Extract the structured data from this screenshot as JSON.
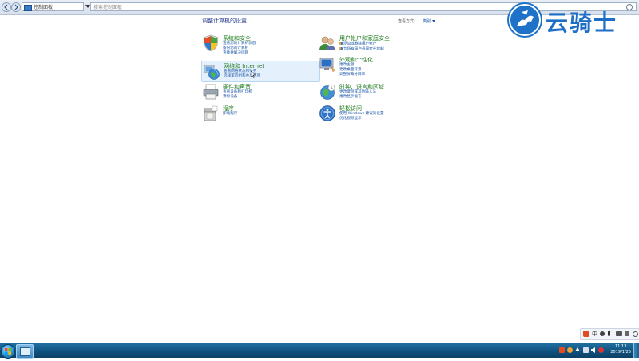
{
  "address_bar": {
    "path": "控制面板",
    "search_placeholder": "搜索控制面板"
  },
  "page_title": "调整计算机的设置",
  "view_by": {
    "label": "查看方式:",
    "value": "类别"
  },
  "categories": [
    {
      "id": "system",
      "title": "系统和安全",
      "links": [
        "查看您的计算机状态",
        "备份您的计算机",
        "查找并解决问题"
      ],
      "icon": "shield-icon"
    },
    {
      "id": "network",
      "title": "网络和 Internet",
      "links": [
        "查看网络状态和任务",
        "选择家庭组和共享选项"
      ],
      "icon": "network-globe-icon"
    },
    {
      "id": "hardware",
      "title": "硬件和声音",
      "links": [
        "查看设备和打印机",
        "添加设备"
      ],
      "icon": "printer-icon"
    },
    {
      "id": "programs",
      "title": "程序",
      "links": [
        "卸载程序"
      ],
      "icon": "programs-icon"
    },
    {
      "id": "users",
      "title": "用户帐户和家庭安全",
      "links": [
        "添加或删除用户帐户",
        "为所有用户设置家长控制"
      ],
      "icon": "users-icon"
    },
    {
      "id": "appearance",
      "title": "外观和个性化",
      "links": [
        "更改主题",
        "更改桌面背景",
        "调整屏幕分辨率"
      ],
      "icon": "appearance-icon"
    },
    {
      "id": "clock",
      "title": "时钟、语言和区域",
      "links": [
        "更改键盘或其他输入法",
        "更改显示语言"
      ],
      "icon": "clock-globe-icon"
    },
    {
      "id": "ease",
      "title": "轻松访问",
      "links": [
        "使用 Windows 建议的设置",
        "优化视频显示"
      ],
      "icon": "ease-of-access-icon"
    }
  ],
  "watermark": {
    "text": "云骑士"
  },
  "taskbar": {
    "time": "11:13",
    "date": "2019/1/25"
  },
  "colors": {
    "category_title": "#1c7a1c",
    "link": "#1e58a8",
    "page_title": "#1e3287",
    "taskbar": "#0d4f7c"
  }
}
